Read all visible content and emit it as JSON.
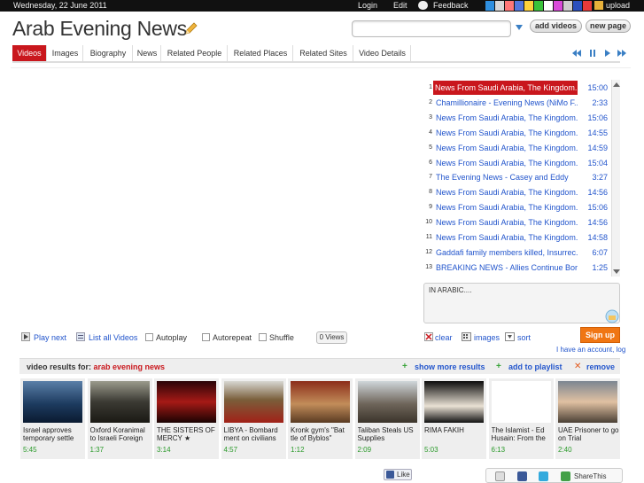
{
  "topbar": {
    "date": "Wednesday, 22 June 2011",
    "login": "Login",
    "edit": "Edit",
    "feedback": "Feedback",
    "upload": "upload",
    "swatches": [
      "#2f8fdf",
      "#d8d8d8",
      "#ff7777",
      "#5577dd",
      "#ffd23c",
      "#3ac23a",
      "#ffffff",
      "#d94bd9",
      "#cfcfcf",
      "#2a4fbd",
      "#e83a3a"
    ]
  },
  "header": {
    "title": "Arab Evening News",
    "search_value": "",
    "add_videos": "add videos",
    "new_page": "new page"
  },
  "tabs": [
    "Videos",
    "Images",
    "Biography",
    "News",
    "Related People",
    "Related Places",
    "Related Sites",
    "Video Details"
  ],
  "playlist": [
    {
      "num": "1",
      "title": "News From Saudi Arabia, The Kingdom...",
      "dur": "15:00"
    },
    {
      "num": "2",
      "title": "Chamillionaire - Evening News (NiMo F...",
      "dur": "2:33"
    },
    {
      "num": "3",
      "title": "News From Saudi Arabia, The Kingdom...",
      "dur": "15:06"
    },
    {
      "num": "4",
      "title": "News From Saudi Arabia, The Kingdom...",
      "dur": "14:55"
    },
    {
      "num": "5",
      "title": "News From Saudi Arabia, The Kingdom...",
      "dur": "14:59"
    },
    {
      "num": "6",
      "title": "News From Saudi Arabia, The Kingdom...",
      "dur": "15:04"
    },
    {
      "num": "7",
      "title": "The Evening News - Casey and Eddy",
      "dur": "3:27"
    },
    {
      "num": "8",
      "title": "News From Saudi Arabia, The Kingdom...",
      "dur": "14:56"
    },
    {
      "num": "9",
      "title": "News From Saudi Arabia, The Kingdom...",
      "dur": "15:06"
    },
    {
      "num": "10",
      "title": "News From Saudi Arabia, The Kingdom...",
      "dur": "14:56"
    },
    {
      "num": "11",
      "title": "News From Saudi Arabia, The Kingdom...",
      "dur": "14:58"
    },
    {
      "num": "12",
      "title": "Gaddafi family members killed, Insurrec...",
      "dur": "6:07"
    },
    {
      "num": "13",
      "title": "BREAKING NEWS - Allies Continue Bor...",
      "dur": "1:25"
    }
  ],
  "description": "IN ARABIC....",
  "controls": {
    "play_next": "Play next",
    "list_all": "List all Videos",
    "autoplay": "Autoplay",
    "autorepeat": "Autorepeat",
    "shuffle": "Shuffle",
    "views": "0 Views",
    "clear": "clear",
    "images": "images",
    "sort": "sort",
    "sign_up": "Sign up",
    "have_account": "I have an account, log"
  },
  "results": {
    "label": "video results for:",
    "query": "arab evening news",
    "show_more": "show more results",
    "add_playlist": "add to playlist",
    "remove": "remove"
  },
  "thumbs": [
    {
      "cap": "Israel approves temporary settle",
      "dur": "5:45"
    },
    {
      "cap": "Oxford Koranimal to Israeli Foreign",
      "dur": "1:37"
    },
    {
      "cap": "THE SISTERS OF MERCY ★",
      "dur": "3:14"
    },
    {
      "cap": "LIBYA - Bombard ment on civilians",
      "dur": "4:57"
    },
    {
      "cap": "Kronk gym's \"Bat tle of Byblos\"",
      "dur": "1:12"
    },
    {
      "cap": "Taliban Steals US Supplies",
      "dur": "2:09"
    },
    {
      "cap": "RIMA FAKIH",
      "dur": "5:03"
    },
    {
      "cap": "The Islamist - Ed Husain: From the",
      "dur": "6:13"
    },
    {
      "cap": "UAE Prisoner to go on Trial",
      "dur": "2:40"
    }
  ],
  "bottom": {
    "like": "Like",
    "share": "ShareThis"
  }
}
